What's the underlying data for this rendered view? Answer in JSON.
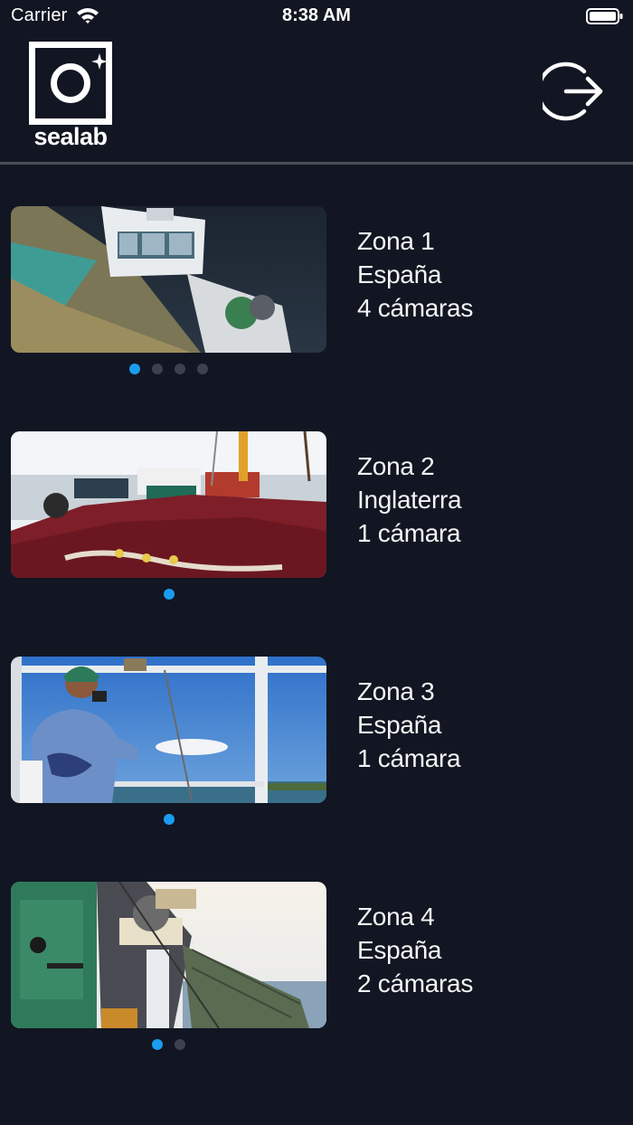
{
  "status_bar": {
    "carrier": "Carrier",
    "time": "8:38 AM",
    "wifi_icon": "wifi-icon",
    "battery_icon": "battery-icon"
  },
  "header": {
    "logo_text": "sealab",
    "logout_icon": "logout-icon"
  },
  "colors": {
    "background": "#111622",
    "divider": "#4a4e57",
    "dot_active": "#1a9cf0",
    "dot_inactive": "#3c414d",
    "text": "#ffffff"
  },
  "zones": [
    {
      "name": "Zona 1",
      "country": "España",
      "cameras": "4 cámaras",
      "image": "fishing boat deck with nets",
      "carousel_pages": 4,
      "active_page": 1
    },
    {
      "name": "Zona 2",
      "country": "Inglaterra",
      "cameras": "1 cámara",
      "image": "harbor with red fishing nets",
      "carousel_pages": 1,
      "active_page": 1
    },
    {
      "name": "Zona 3",
      "country": "España",
      "cameras": "1 cámara",
      "image": "fisherman on boat deck",
      "carousel_pages": 1,
      "active_page": 1
    },
    {
      "name": "Zona 4",
      "country": "España",
      "cameras": "2 cámaras",
      "image": "trawler winch and net at sea",
      "carousel_pages": 2,
      "active_page": 1
    }
  ]
}
